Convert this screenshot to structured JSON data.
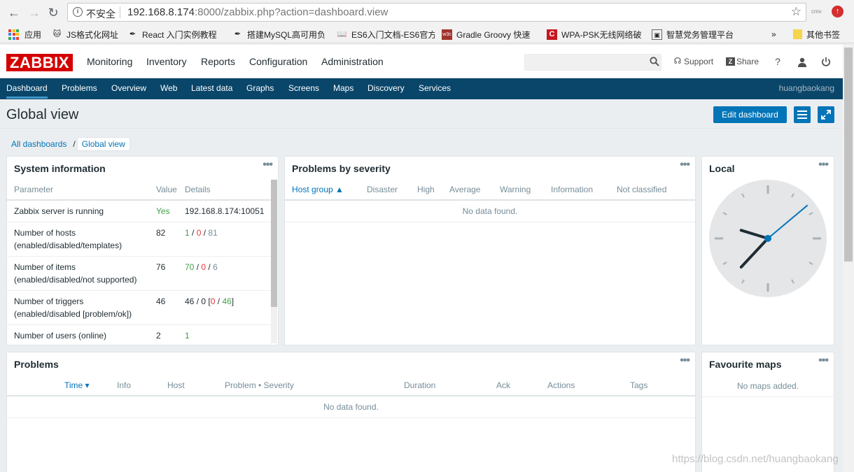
{
  "browser": {
    "security_label": "不安全",
    "url_host": "192.168.8.174",
    "url_rest": ":8000/zabbix.php?action=dashboard.view",
    "extension_label": "cmv"
  },
  "bookmarks": [
    {
      "label": "应用",
      "icon": "apps-grid-icon"
    },
    {
      "label": "JS格式化网址",
      "icon": "cat-icon"
    },
    {
      "label": "React 入门实例教程",
      "icon": "feather-icon"
    },
    {
      "label": "搭建MySQL高可用负",
      "icon": "feather-icon"
    },
    {
      "label": "ES6入门文档-ES6官方",
      "icon": "book-icon"
    },
    {
      "label": "Gradle Groovy 快速",
      "icon": "w3c-icon"
    },
    {
      "label": "WPA-PSK无线网络破",
      "icon": "c-icon"
    },
    {
      "label": "智慧党务管理平台",
      "icon": "image-icon"
    },
    {
      "label": "其他书签",
      "icon": "folder-icon"
    }
  ],
  "bookmarks_overflow": "»",
  "header": {
    "logo": "ZABBIX",
    "menu": [
      "Monitoring",
      "Inventory",
      "Reports",
      "Configuration",
      "Administration"
    ],
    "active_menu": "Monitoring",
    "search_placeholder": "",
    "support": "Support",
    "share": "Share",
    "help": "?"
  },
  "subnav": {
    "items": [
      "Dashboard",
      "Problems",
      "Overview",
      "Web",
      "Latest data",
      "Graphs",
      "Screens",
      "Maps",
      "Discovery",
      "Services"
    ],
    "active": "Dashboard",
    "user": "huangbaokang"
  },
  "page": {
    "title": "Global view",
    "edit_button": "Edit dashboard",
    "breadcrumb": [
      "All dashboards",
      "Global view"
    ]
  },
  "system_info": {
    "title": "System information",
    "columns": [
      "Parameter",
      "Value",
      "Details"
    ],
    "rows": [
      {
        "param": [
          "Zabbix server is running"
        ],
        "value": "Yes",
        "details": "192.168.8.174:10051"
      },
      {
        "param": [
          "Number of hosts",
          "(enabled/disabled/templates)"
        ],
        "value": "82",
        "d1": "1",
        "d2": "0",
        "d3": "81"
      },
      {
        "param": [
          "Number of items",
          "(enabled/disabled/not supported)"
        ],
        "value": "76",
        "d1": "70",
        "d2": "0",
        "d3": "6"
      },
      {
        "param": [
          "Number of triggers",
          "(enabled/disabled [problem/ok])"
        ],
        "value": "46",
        "d1": "46",
        "d2": "0",
        "d3": "0",
        "d4": "46"
      },
      {
        "param": [
          "Number of users (online)"
        ],
        "value": "2",
        "details": "1"
      }
    ]
  },
  "severity": {
    "title": "Problems by severity",
    "columns": [
      "Host group ▲",
      "Disaster",
      "High",
      "Average",
      "Warning",
      "Information",
      "Not classified"
    ],
    "empty": "No data found."
  },
  "clock": {
    "title": "Local",
    "hour_angle_deg": 287,
    "minute_angle_deg": 223,
    "second_angle_deg": 50
  },
  "problems": {
    "title": "Problems",
    "columns": [
      "Time ▾",
      "Info",
      "Host",
      "Problem • Severity",
      "Duration",
      "Ack",
      "Actions",
      "Tags"
    ],
    "empty": "No data found."
  },
  "fav_maps": {
    "title": "Favourite maps",
    "empty": "No maps added."
  },
  "widget_menu": "•••",
  "watermark": "https://blog.csdn.net/huangbaokang",
  "colors": {
    "brand_red": "#d40000",
    "nav_blue": "#0a466a",
    "button_blue": "#0275b8",
    "ok_green": "#429e47",
    "problem_red": "#e33734"
  }
}
